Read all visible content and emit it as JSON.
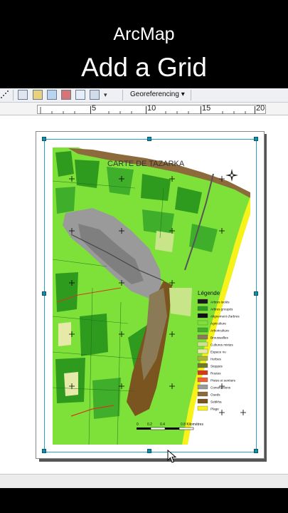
{
  "caption": {
    "app_name": "ArcMap",
    "tutorial_title": "Add a Grid"
  },
  "toolbar": {
    "georeferencing_label": "Georeferencing ▾",
    "icons": [
      "layout-icon",
      "table-icon",
      "add-data-icon",
      "toolbox-icon",
      "python-icon",
      "model-icon",
      "more-icon"
    ]
  },
  "ruler": {
    "ticks": [
      "5",
      "10",
      "15",
      "20"
    ]
  },
  "map": {
    "title": "CARTE DE TAZARKA",
    "legend_title": "Légende",
    "legend_items": [
      {
        "label": "Arbres isolés",
        "color": "#1a1a1a"
      },
      {
        "label": "Arbres groupés",
        "color": "#2e9b1e"
      },
      {
        "label": "Alignement d'arbres",
        "color": "#111111"
      },
      {
        "label": "Agriculture",
        "color": "#7ee13a"
      },
      {
        "label": "Arboriculture",
        "color": "#3fae2a"
      },
      {
        "label": "Broussailles",
        "color": "#8a7a55"
      },
      {
        "label": "Cultures mixtes",
        "color": "#c9e58a"
      },
      {
        "label": "Espace nu",
        "color": "#e6e9a8"
      },
      {
        "label": "Herbes",
        "color": "#a7b63a"
      },
      {
        "label": "Steppes",
        "color": "#6e7b2a"
      },
      {
        "label": "Routes",
        "color": "#d23a1e"
      },
      {
        "label": "Pistes et sentiers",
        "color": "#e8603c"
      },
      {
        "label": "Constructions",
        "color": "#9a9a9a"
      },
      {
        "label": "Oueds",
        "color": "#8c6a3c"
      },
      {
        "label": "Sebkha",
        "color": "#7a5520"
      },
      {
        "label": "Plage",
        "color": "#f6f21a"
      }
    ],
    "scale_labels": [
      "0",
      "0.2",
      "0.4",
      "0.8 Kilomètres"
    ]
  },
  "colors": {
    "agriculture": "#7ee13a",
    "forest": "#2e9b1e",
    "urban": "#9a9a9a",
    "beach": "#f6f21a",
    "sea": "#ffffff",
    "selection": "#0f8fa8"
  }
}
